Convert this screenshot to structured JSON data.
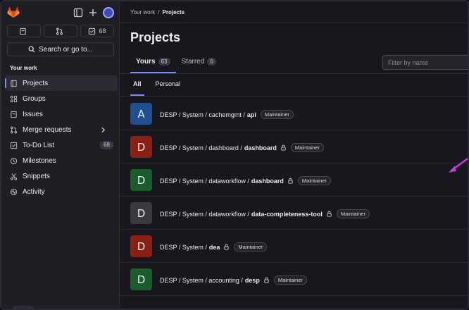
{
  "sidebar": {
    "counters": [
      {
        "icon": "issue-icon",
        "value": ""
      },
      {
        "icon": "merge-request-icon",
        "value": ""
      },
      {
        "icon": "todo-icon",
        "value": "68"
      }
    ],
    "search_label": "Search or go to...",
    "section_title": "Your work",
    "items": [
      {
        "label": "Projects",
        "icon": "project-icon",
        "active": true
      },
      {
        "label": "Groups",
        "icon": "group-icon"
      },
      {
        "label": "Issues",
        "icon": "issues-icon"
      },
      {
        "label": "Merge requests",
        "icon": "merge-request-icon",
        "chevron": true
      },
      {
        "label": "To-Do List",
        "icon": "todo-icon",
        "badge": "68"
      },
      {
        "label": "Milestones",
        "icon": "milestone-icon"
      },
      {
        "label": "Snippets",
        "icon": "snippet-icon"
      },
      {
        "label": "Activity",
        "icon": "activity-icon"
      }
    ]
  },
  "breadcrumb": {
    "parent": "Your work",
    "separator": "/",
    "current": "Projects"
  },
  "page_title": "Projects",
  "tabs": [
    {
      "label": "Yours",
      "count": "63",
      "active": true
    },
    {
      "label": "Starred",
      "count": "0"
    }
  ],
  "filter": {
    "placeholder": "Filter by name"
  },
  "subtabs": [
    {
      "label": "All",
      "active": true
    },
    {
      "label": "Personal"
    }
  ],
  "projects": [
    {
      "letter": "A",
      "color": "#1f4f8f",
      "path": "DESP / System / cachemgmt /",
      "name": "api",
      "locked": false,
      "role": "Maintainer"
    },
    {
      "letter": "D",
      "color": "#8a1f14",
      "path": "DESP / System / dashboard /",
      "name": "dashboard",
      "locked": true,
      "role": "Maintainer"
    },
    {
      "letter": "D",
      "color": "#1b5c2c",
      "path": "DESP / System / dataworkflow /",
      "name": "dashboard",
      "locked": true,
      "role": "Maintainer"
    },
    {
      "letter": "D",
      "color": "#3a3940",
      "path": "DESP / System / dataworkflow /",
      "name": "data-completeness-tool",
      "locked": true,
      "role": "Maintainer"
    },
    {
      "letter": "D",
      "color": "#8a1f14",
      "path": "DESP / System /",
      "name": "dea",
      "locked": true,
      "role": "Maintainer"
    },
    {
      "letter": "D",
      "color": "#1b5c2c",
      "path": "DESP / System / accounting /",
      "name": "desp",
      "locked": true,
      "role": "Maintainer"
    }
  ],
  "colors": {
    "accent": "#7b8cff",
    "annotation_arrow": "#c03ad6",
    "brand_logo": "#e24329"
  }
}
